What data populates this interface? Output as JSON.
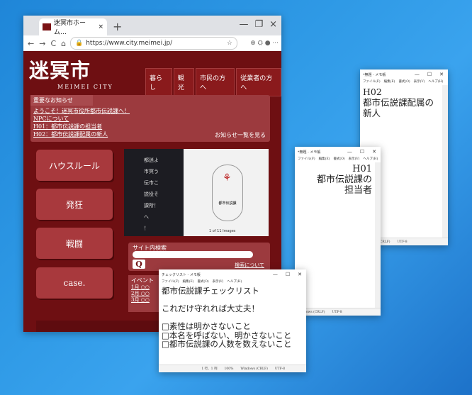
{
  "browser": {
    "tab_title": "迷冥市ホーム…",
    "tab_close": "×",
    "new_tab": "+",
    "window_controls": [
      "—",
      "❐",
      "×"
    ],
    "nav": [
      "←",
      "→",
      "C",
      "⌂"
    ],
    "url": "https://www.city.meimei.jp/",
    "ext_icons": "⊕ ⛭ ● ···"
  },
  "site": {
    "logo": "迷冥市",
    "logo_sub": "MEIMEI CITY",
    "nav": [
      "暮らし",
      "観光",
      "市民の方へ",
      "従業者の方へ"
    ],
    "news_heading": "重要なお知らせ",
    "news": [
      "ようこそ！迷冥市役所都市伝説課へ！",
      "NPCについて",
      "H01：都市伝説課の担当者",
      "H02：都市伝説課配属の新人"
    ],
    "news_more": "お知らせ一覧を見る",
    "side_buttons": [
      "ハウスルール",
      "発狂",
      "戦闘",
      "case."
    ],
    "banner_text": [
      "都迷よ",
      "市冥う",
      "伝市こ",
      "説役そ",
      "課所！",
      "へ",
      "！"
    ],
    "banner_label": "都市伝説課",
    "banner_page": "1 of 11 Images",
    "search_label": "サイト内検索",
    "search_detail": "検索について",
    "events_heading": "イベント",
    "events": [
      "1月 ○○",
      "2月 ○○",
      "3月 ○○"
    ]
  },
  "notepads": [
    {
      "title": "*無題 - メモ帳",
      "menu": [
        "ファイル(F)",
        "編集(E)",
        "書式(O)",
        "表示(V)",
        "ヘルプ(H)"
      ],
      "body": "H02\n都市伝説課配属の\n新人",
      "status": [
        "Windows (CRLF)",
        "UTF-8"
      ]
    },
    {
      "title": "*無題 - メモ帳",
      "menu": [
        "ファイル(F)",
        "編集(E)",
        "書式(O)",
        "表示(V)",
        "ヘルプ(H)"
      ],
      "body": "H01\n都市伝説課の\n担当者",
      "status": [
        "Windows (CRLF)",
        "UTF-8"
      ]
    },
    {
      "title": "チェックリスト - メモ帳",
      "menu": [
        "ファイル(F)",
        "編集(E)",
        "書式(O)",
        "表示(V)",
        "ヘルプ(H)"
      ],
      "body": "都市伝説課チェックリスト\n\nこれだけ守れれば大丈夫！\n\n□素性は明かさないこと\n□本名を呼ばない、明かさないこと\n□都市伝説課の人数を数えないこと",
      "status": [
        "1 行、1 列",
        "100%",
        "Windows (CRLF)",
        "UTF-8"
      ]
    }
  ],
  "colors": {
    "site_bg": "#6e0f12",
    "site_panel": "#a8393d",
    "desktop": "#2f9ae6"
  }
}
